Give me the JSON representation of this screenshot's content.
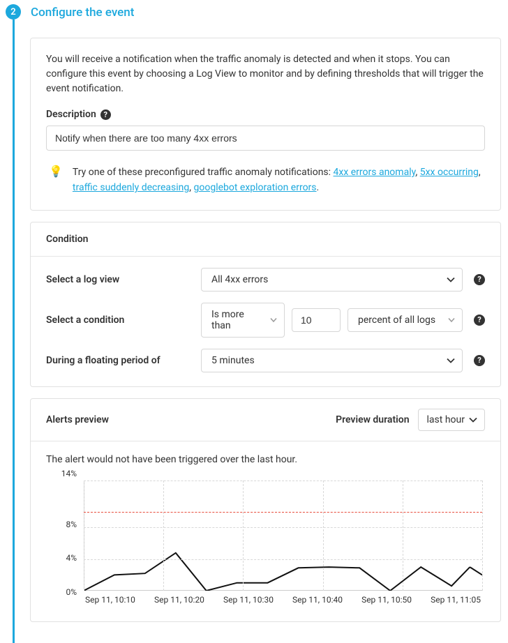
{
  "step": {
    "number": "2",
    "title": "Configure the event"
  },
  "intro": "You will receive a notification when the traffic anomaly is detected and when it stops. You can configure this event by choosing a Log View to monitor and by defining thresholds that will trigger the event notification.",
  "description": {
    "label": "Description",
    "value": "Notify when there are too many 4xx errors"
  },
  "tip": {
    "prefix": "Try one of these preconfigured traffic anomaly notifications: ",
    "links": {
      "l1": "4xx errors anomaly",
      "l2": "5xx occurring",
      "l3": "traffic suddenly decreasing",
      "l4": "googlebot exploration errors"
    }
  },
  "condition": {
    "header": "Condition",
    "logview_label": "Select a log view",
    "logview_value": "All 4xx errors",
    "cond_label": "Select a condition",
    "cond_value": "Is more than",
    "threshold_value": "10",
    "unit_value": "percent of all logs",
    "period_label": "During a floating period of",
    "period_value": "5 minutes"
  },
  "preview": {
    "header": "Alerts preview",
    "duration_label": "Preview duration",
    "duration_value": "last hour",
    "message": "The alert would not have been triggered over the last hour."
  },
  "chart_data": {
    "type": "line",
    "ylabel": "",
    "ylim": [
      0,
      14
    ],
    "y_ticks": [
      0,
      4,
      8,
      14
    ],
    "threshold": 10,
    "x_labels": [
      "Sep 11, 10:10",
      "Sep 11, 10:20",
      "Sep 11, 10:30",
      "Sep 11, 10:40",
      "Sep 11, 10:50",
      "Sep 11, 11:05"
    ],
    "series": [
      {
        "name": "pct",
        "x": [
          0,
          5,
          10,
          15,
          20,
          25,
          30,
          35,
          40,
          45,
          50,
          55,
          60,
          63
        ],
        "values": [
          0.0,
          2.0,
          2.2,
          4.8,
          0.0,
          1.0,
          1.0,
          2.9,
          3.0,
          2.9,
          0.0,
          3.0,
          0.6,
          3.0
        ]
      },
      {
        "name": "last",
        "x": [
          63,
          65
        ],
        "values": [
          3.0,
          2.0
        ]
      }
    ]
  }
}
